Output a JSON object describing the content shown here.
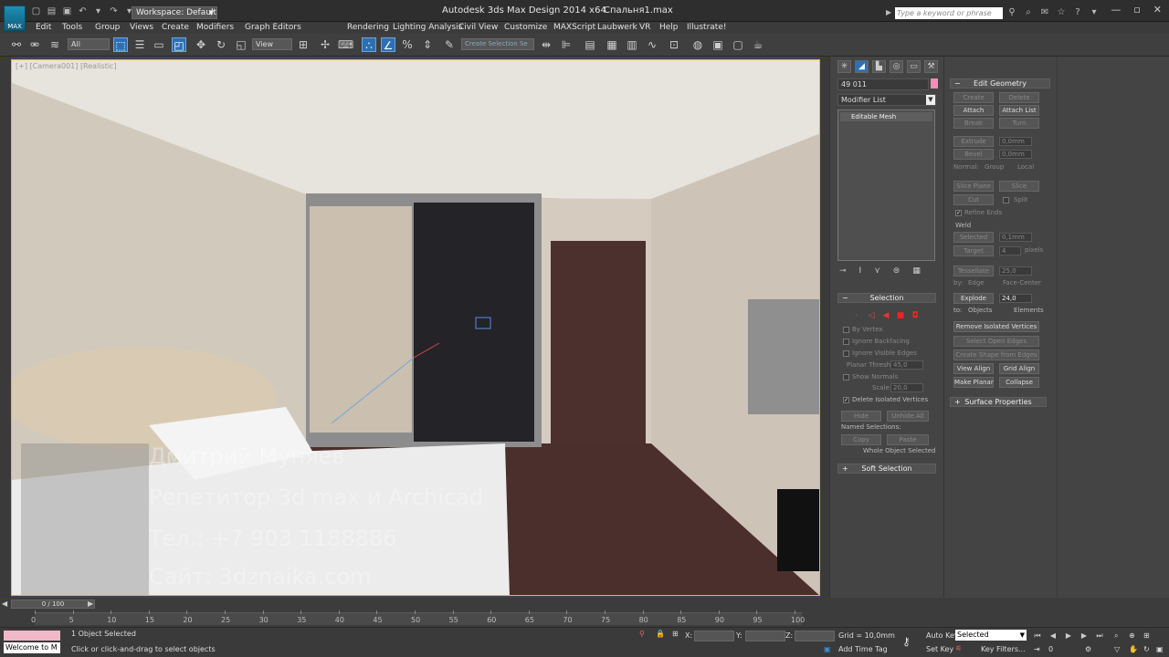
{
  "window": {
    "title": "Autodesk 3ds Max Design 2014 x64",
    "filename": "Спальня1.max",
    "workspace_label": "Workspace: Default",
    "search_placeholder": "Type a keyword or phrase",
    "logo_text": "MAX"
  },
  "menu": [
    "Edit",
    "Tools",
    "Group",
    "Views",
    "Create",
    "Modifiers",
    "Graph Editors",
    "Rendering",
    "Lighting Analysis",
    "Civil View",
    "Customize",
    "MAXScript",
    "Laubwerk",
    "VR",
    "Help",
    "Illustrate!"
  ],
  "toolbar": {
    "filter_value": "All",
    "refcoord_value": "View",
    "selection_set_placeholder": "Create Selection Se"
  },
  "viewport": {
    "label": "[+] [Camera001] [Realistic]",
    "watermark_lines": [
      "Дмитрий Муняев",
      "Репетитор 3d max и Archicad",
      "Тел.: +7 903 1188886",
      "Сайт: 3dznaika.com"
    ]
  },
  "command_panel": {
    "object_name": "49  011",
    "object_color": "#f58db4",
    "modifier_list": "Modifier List",
    "stack_item": "Editable Mesh",
    "selection": {
      "title": "Selection",
      "by_vertex": "By Vertex",
      "ignore_backfacing": "Ignore Backfacing",
      "ignore_visible_edges": "Ignore Visible Edges",
      "planar_thresh_label": "Planar Thresh:",
      "planar_thresh_value": "45,0",
      "show_normals": "Show Normals",
      "scale_label": "Scale:",
      "scale_value": "20,0",
      "delete_isolated": "Delete Isolated Vertices",
      "hide": "Hide",
      "unhide_all": "Unhide All",
      "named_selections": "Named Selections:",
      "copy": "Copy",
      "paste": "Paste",
      "status": "Whole Object Selected"
    },
    "soft_selection": "Soft Selection"
  },
  "edit_geometry": {
    "title": "Edit Geometry",
    "create": "Create",
    "delete": "Delete",
    "attach": "Attach",
    "attach_list": "Attach List",
    "break": "Break",
    "turn": "Turn",
    "extrude": "Extrude",
    "extrude_value": "0,0mm",
    "bevel": "Bevel",
    "bevel_value": "0,0mm",
    "normal_label": "Normal:",
    "group": "Group",
    "local": "Local",
    "slice_plane": "Slice Plane",
    "slice": "Slice",
    "cut": "Cut",
    "split": "Split",
    "refine_ends": "Refine Ends",
    "weld": "Weld",
    "selected": "Selected",
    "selected_value": "0,1mm",
    "target": "Target",
    "target_value": "4",
    "pixels": "pixels",
    "tessellate": "Tessellate",
    "tessellate_value": "25,0",
    "by_label": "by:",
    "edge": "Edge",
    "face_center": "Face-Center",
    "explode": "Explode",
    "explode_value": "24,0",
    "to_label": "to:",
    "objects": "Objects",
    "elements": "Elements",
    "remove_isolated": "Remove Isolated Vertices",
    "select_open_edges": "Select Open Edges",
    "create_shape": "Create Shape from Edges",
    "view_align": "View Align",
    "grid_align": "Grid Align",
    "make_planar": "Make Planar",
    "collapse": "Collapse",
    "surface_properties": "Surface Properties"
  },
  "timeline": {
    "slider": "0 / 100",
    "ticks": [
      "0",
      "5",
      "10",
      "15",
      "20",
      "25",
      "30",
      "35",
      "40",
      "45",
      "50",
      "55",
      "60",
      "65",
      "70",
      "75",
      "80",
      "85",
      "90",
      "95",
      "100"
    ]
  },
  "status": {
    "maxscript": "Welcome to M",
    "selected_count": "1 Object Selected",
    "prompt": "Click or click-and-drag to select objects",
    "x_label": "X:",
    "y_label": "Y:",
    "z_label": "Z:",
    "grid": "Grid = 10,0mm",
    "add_time_tag": "Add Time Tag",
    "auto_key": "Auto Key",
    "auto_key_value": "Selected",
    "set_key": "Set Key",
    "key_filters": "Key Filters...",
    "frame": "0"
  }
}
